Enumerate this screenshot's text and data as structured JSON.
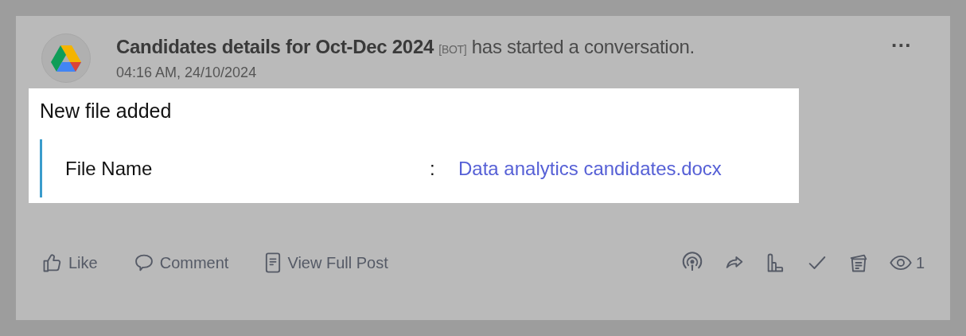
{
  "post": {
    "author": "Candidates details for Oct-Dec 2024",
    "badge": "[BOT]",
    "message": "has started a conversation.",
    "time": "04:16 AM, 24/10/2024",
    "more": "···"
  },
  "content": {
    "heading": "New file added",
    "fields": [
      {
        "label": "File Name",
        "separator": ":",
        "value": "Data analytics candidates.docx"
      }
    ]
  },
  "actions": [
    {
      "kind": "like",
      "label": "Like"
    },
    {
      "kind": "comment",
      "label": "Comment"
    },
    {
      "kind": "view",
      "label": "View Full Post"
    }
  ],
  "tools": [
    {
      "kind": "broadcast"
    },
    {
      "kind": "share"
    },
    {
      "kind": "stats"
    },
    {
      "kind": "check"
    },
    {
      "kind": "notes"
    },
    {
      "kind": "views",
      "count": "1"
    }
  ]
}
